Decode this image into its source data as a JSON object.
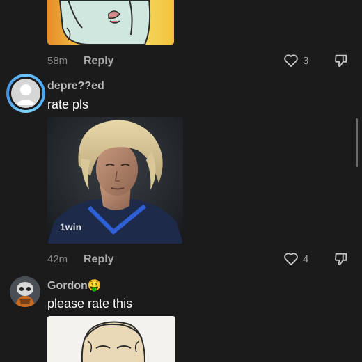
{
  "comment0": {
    "time": "58m",
    "reply_label": "Reply",
    "likes": "3"
  },
  "comment1": {
    "username": "depre??ed",
    "text": "rate pls",
    "time": "42m",
    "reply_label": "Reply",
    "likes": "4",
    "image_watermark": "1win"
  },
  "comment2": {
    "username": "Gordon🤑",
    "text": "please rate this"
  },
  "colors": {
    "background": "#1b1b1b",
    "avatar_ring": "#42a5f5",
    "muted_text": "#a8a8a8"
  }
}
